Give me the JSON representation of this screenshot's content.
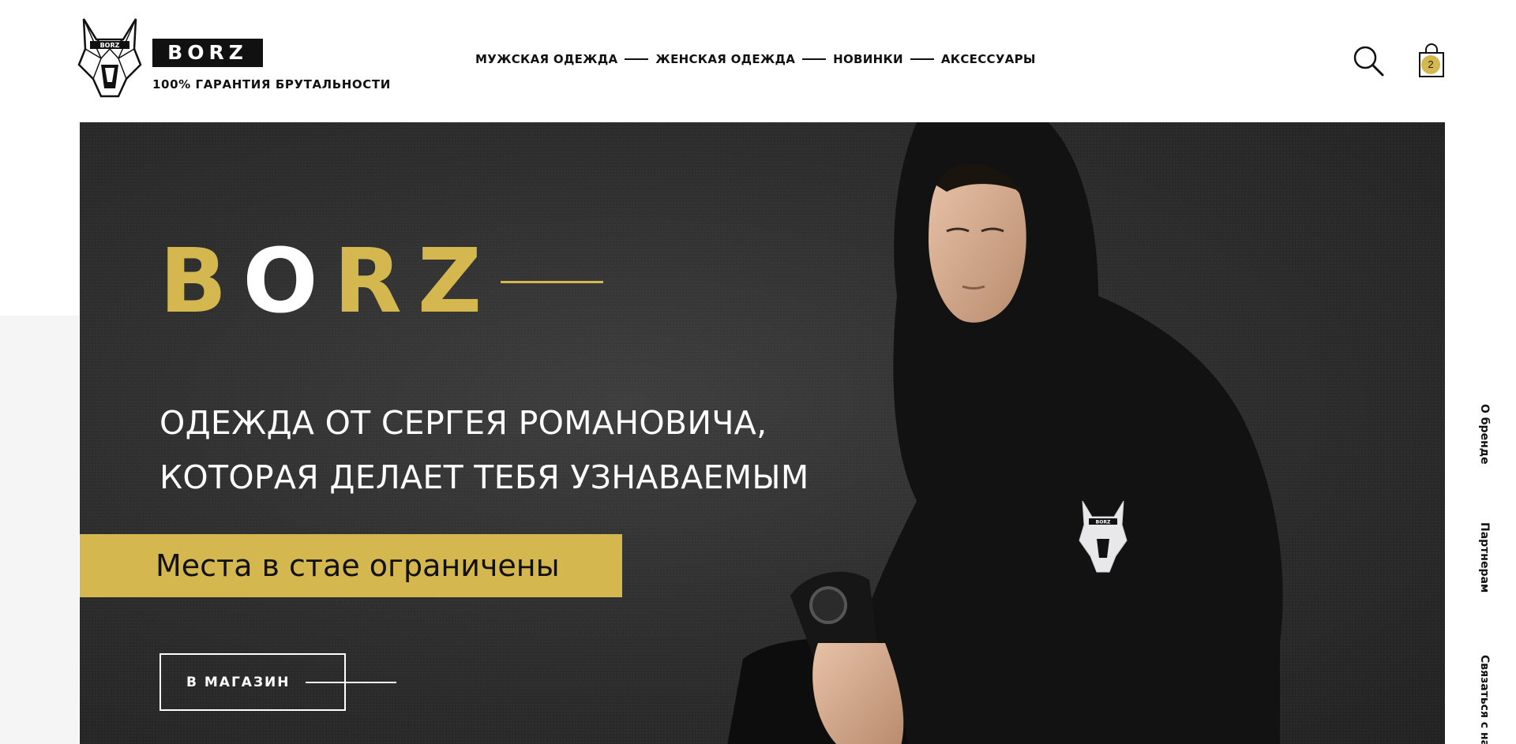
{
  "header": {
    "brand": "BORZ",
    "tagline": "100% ГАРАНТИЯ БРУТАЛЬНОСТИ",
    "logo_icon": "wolf-logo-icon",
    "logo_text": "BORZ"
  },
  "nav": {
    "items": [
      {
        "label": "МУЖСКАЯ ОДЕЖДА"
      },
      {
        "label": "ЖЕНСКАЯ ОДЕЖДА"
      },
      {
        "label": "НОВИНКИ"
      },
      {
        "label": "АКСЕССУАРЫ"
      }
    ]
  },
  "actions": {
    "search_icon": "search-icon",
    "cart_icon": "shopping-bag-icon",
    "cart_count": "2"
  },
  "hero": {
    "title_letters": [
      "B",
      "O",
      "R",
      "Z"
    ],
    "subtitle_lines": [
      "ОДЕЖДА ОТ СЕРГЕЯ РОМАНОВИЧА,",
      "КОТОРАЯ ДЕЛАЕТ ТЕБЯ УЗНАВАЕМЫМ"
    ],
    "banner": "Места в стае ограничены",
    "cta": "В МАГАЗИН",
    "photo_chest_logo_text": "BORZ"
  },
  "side_links": [
    {
      "label": "О бренде"
    },
    {
      "label": "Партнерам"
    },
    {
      "label": "Связаться с на"
    }
  ],
  "colors": {
    "accent_gold": "#d4b84f",
    "hero_bg": "#2f2f2f",
    "text_dark": "#111111"
  }
}
